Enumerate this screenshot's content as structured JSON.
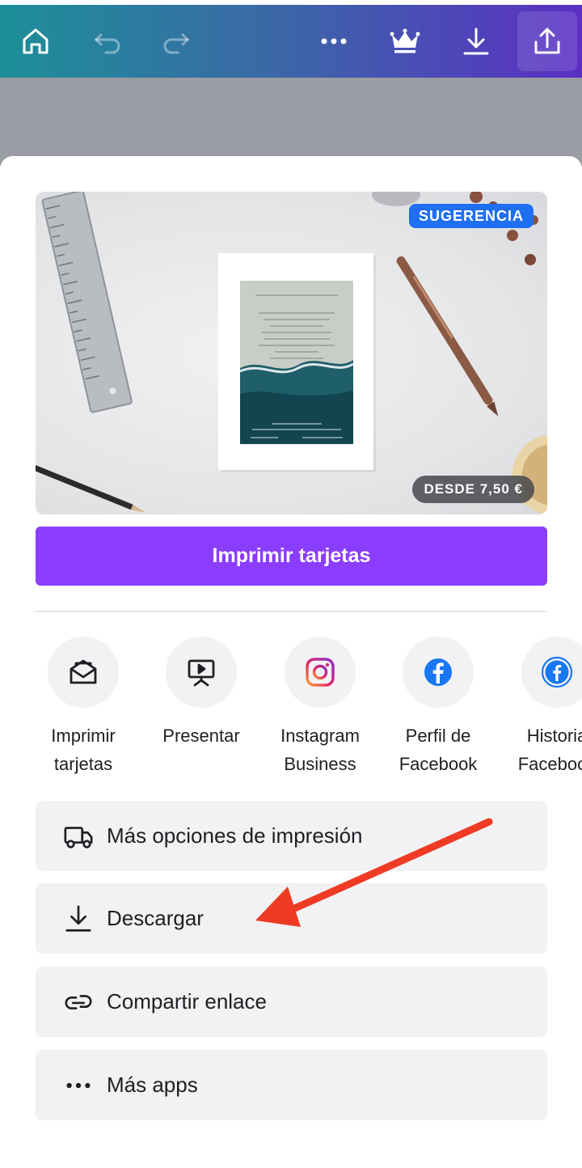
{
  "toolbar": {
    "icons": [
      "home-icon",
      "undo-icon",
      "redo-icon",
      "more-icon",
      "crown-icon",
      "download-icon",
      "share-icon"
    ]
  },
  "hero": {
    "badge_suggestion": "SUGERENCIA",
    "badge_price": "DESDE 7,50 €"
  },
  "cta": {
    "label": "Imprimir tarjetas",
    "color": "#8b3dff"
  },
  "share_options": [
    {
      "label": "Imprimir\ntarjetas",
      "icon": "envelope-icon"
    },
    {
      "label": "Presentar",
      "icon": "presentation-icon"
    },
    {
      "label": "Instagram\nBusiness",
      "icon": "instagram-icon"
    },
    {
      "label": "Perfil de\nFacebook",
      "icon": "facebook-icon"
    },
    {
      "label": "Historia\nFacebook",
      "icon": "facebook-story-icon"
    }
  ],
  "options": [
    {
      "label": "Más opciones de impresión",
      "icon": "truck-icon"
    },
    {
      "label": "Descargar",
      "icon": "download-icon"
    },
    {
      "label": "Compartir enlace",
      "icon": "link-icon"
    },
    {
      "label": "Más apps",
      "icon": "more-icon"
    }
  ],
  "colors": {
    "badge": "#1f6ff2",
    "annotation_arrow": "#ef3b24"
  }
}
